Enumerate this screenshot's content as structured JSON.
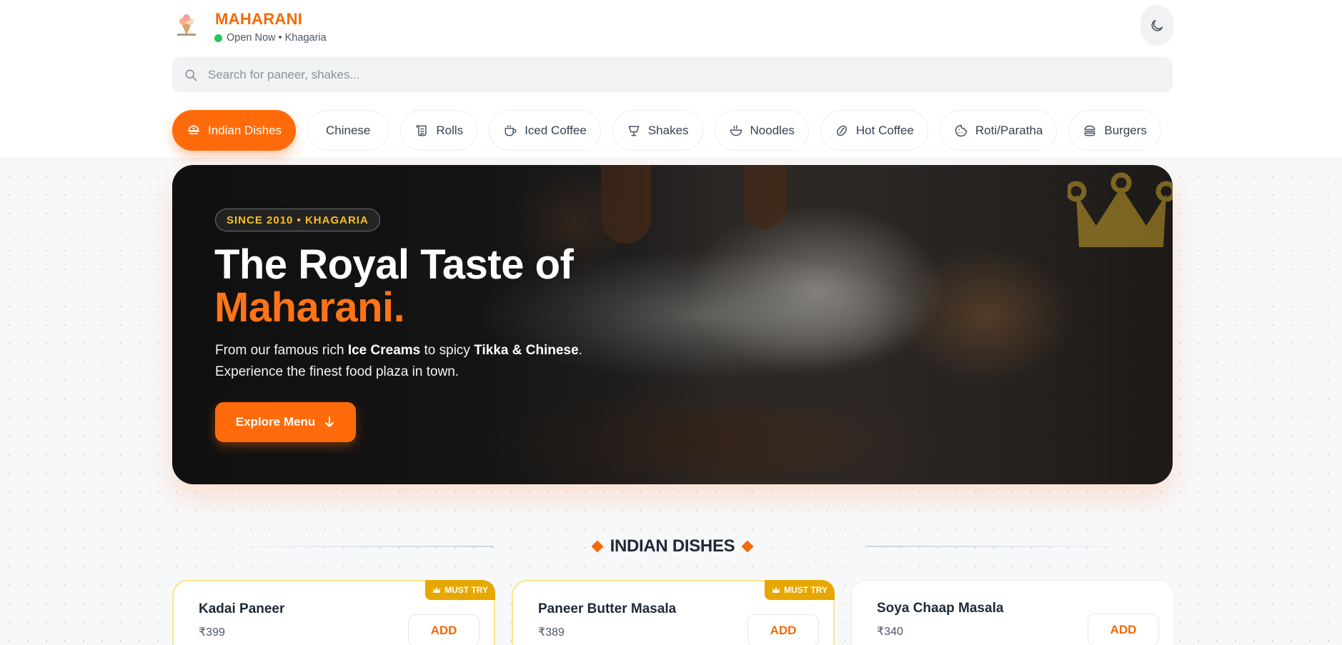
{
  "header": {
    "brand_name": "MAHARANI",
    "status_text": "Open Now • Khagaria",
    "logo_icon": "maharani-logo",
    "theme_toggle_icon": "moon-icon"
  },
  "search": {
    "placeholder": "Search for paneer, shakes...",
    "value": ""
  },
  "categories": [
    {
      "label": "Indian Dishes",
      "icon": "dish-icon",
      "active": true
    },
    {
      "label": "Chinese",
      "icon": "",
      "active": false
    },
    {
      "label": "Rolls",
      "icon": "scroll-icon",
      "active": false
    },
    {
      "label": "Iced Coffee",
      "icon": "cup-icon",
      "active": false
    },
    {
      "label": "Shakes",
      "icon": "glass-icon",
      "active": false
    },
    {
      "label": "Noodles",
      "icon": "bowl-icon",
      "active": false
    },
    {
      "label": "Hot Coffee",
      "icon": "bean-icon",
      "active": false
    },
    {
      "label": "Roti/Paratha",
      "icon": "cookie-icon",
      "active": false
    },
    {
      "label": "Burgers",
      "icon": "burger-icon",
      "active": false
    }
  ],
  "hero": {
    "badge": "SINCE 2010 • KHAGARIA",
    "title_line1": "The Royal Taste of",
    "title_line2": "Maharani.",
    "desc_part1": "From our famous rich ",
    "desc_bold1": "Ice Creams",
    "desc_part2": " to spicy ",
    "desc_bold2": "Tikka & Chinese",
    "desc_part3": ".",
    "desc_line2": "Experience the finest food plaza in town.",
    "cta_label": "Explore Menu"
  },
  "section": {
    "title": "INDIAN DISHES"
  },
  "dishes": [
    {
      "name": "Kadai Paneer",
      "price": "₹399",
      "badge": "MUST TRY",
      "add_label": "ADD"
    },
    {
      "name": "Paneer Butter Masala",
      "price": "₹389",
      "badge": "MUST TRY",
      "add_label": "ADD"
    },
    {
      "name": "Soya Chaap Masala",
      "price": "₹340",
      "badge": "",
      "add_label": "ADD"
    }
  ],
  "colors": {
    "accent": "#ff6b0a",
    "brand": "#f26a0a",
    "status_online": "#22c55e",
    "badge_gold": "#e6a800"
  }
}
